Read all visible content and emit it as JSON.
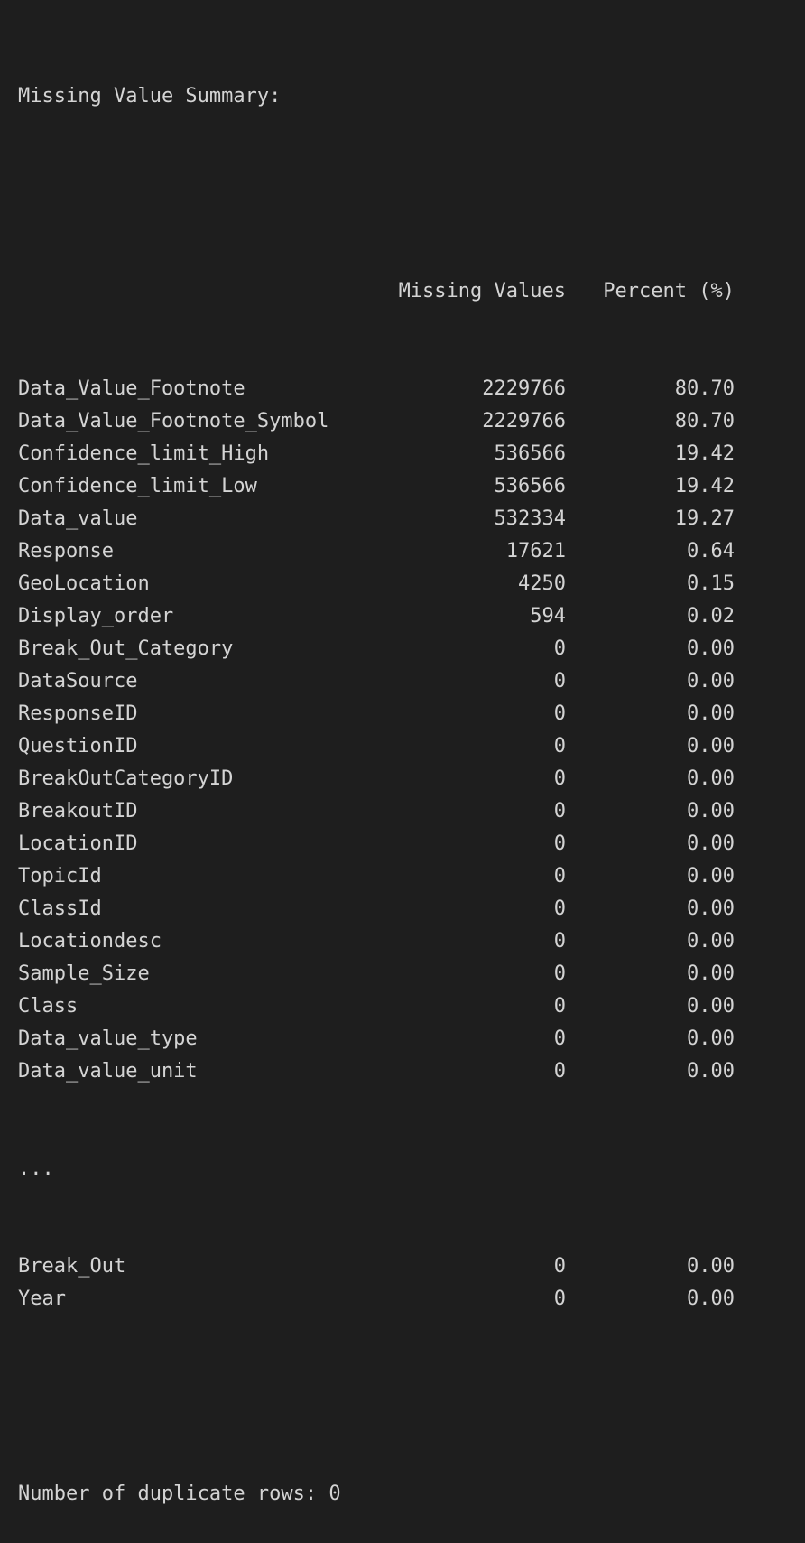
{
  "console": {
    "summary_title": "Missing Value Summary:",
    "columns": {
      "missing_values": "Missing Values",
      "percent": "Percent (%)"
    },
    "rows": [
      {
        "name": "Data_Value_Footnote",
        "missing": "2229766",
        "percent": "80.70"
      },
      {
        "name": "Data_Value_Footnote_Symbol",
        "missing": "2229766",
        "percent": "80.70"
      },
      {
        "name": "Confidence_limit_High",
        "missing": "536566",
        "percent": "19.42"
      },
      {
        "name": "Confidence_limit_Low",
        "missing": "536566",
        "percent": "19.42"
      },
      {
        "name": "Data_value",
        "missing": "532334",
        "percent": "19.27"
      },
      {
        "name": "Response",
        "missing": "17621",
        "percent": "0.64"
      },
      {
        "name": "GeoLocation",
        "missing": "4250",
        "percent": "0.15"
      },
      {
        "name": "Display_order",
        "missing": "594",
        "percent": "0.02"
      },
      {
        "name": "Break_Out_Category",
        "missing": "0",
        "percent": "0.00"
      },
      {
        "name": "DataSource",
        "missing": "0",
        "percent": "0.00"
      },
      {
        "name": "ResponseID",
        "missing": "0",
        "percent": "0.00"
      },
      {
        "name": "QuestionID",
        "missing": "0",
        "percent": "0.00"
      },
      {
        "name": "BreakOutCategoryID",
        "missing": "0",
        "percent": "0.00"
      },
      {
        "name": "BreakoutID",
        "missing": "0",
        "percent": "0.00"
      },
      {
        "name": "LocationID",
        "missing": "0",
        "percent": "0.00"
      },
      {
        "name": "TopicId",
        "missing": "0",
        "percent": "0.00"
      },
      {
        "name": "ClassId",
        "missing": "0",
        "percent": "0.00"
      },
      {
        "name": "Locationdesc",
        "missing": "0",
        "percent": "0.00"
      },
      {
        "name": "Sample_Size",
        "missing": "0",
        "percent": "0.00"
      },
      {
        "name": "Class",
        "missing": "0",
        "percent": "0.00"
      },
      {
        "name": "Data_value_type",
        "missing": "0",
        "percent": "0.00"
      },
      {
        "name": "Data_value_unit",
        "missing": "0",
        "percent": "0.00"
      }
    ],
    "ellipsis": "...",
    "tail_rows": [
      {
        "name": "Break_Out",
        "missing": "0",
        "percent": "0.00"
      },
      {
        "name": "Year",
        "missing": "0",
        "percent": "0.00"
      }
    ],
    "duplicates_text": "Number of duplicate rows: 0"
  },
  "colors": {
    "background": "#1e1e1e",
    "text": "#d4d4d4"
  }
}
